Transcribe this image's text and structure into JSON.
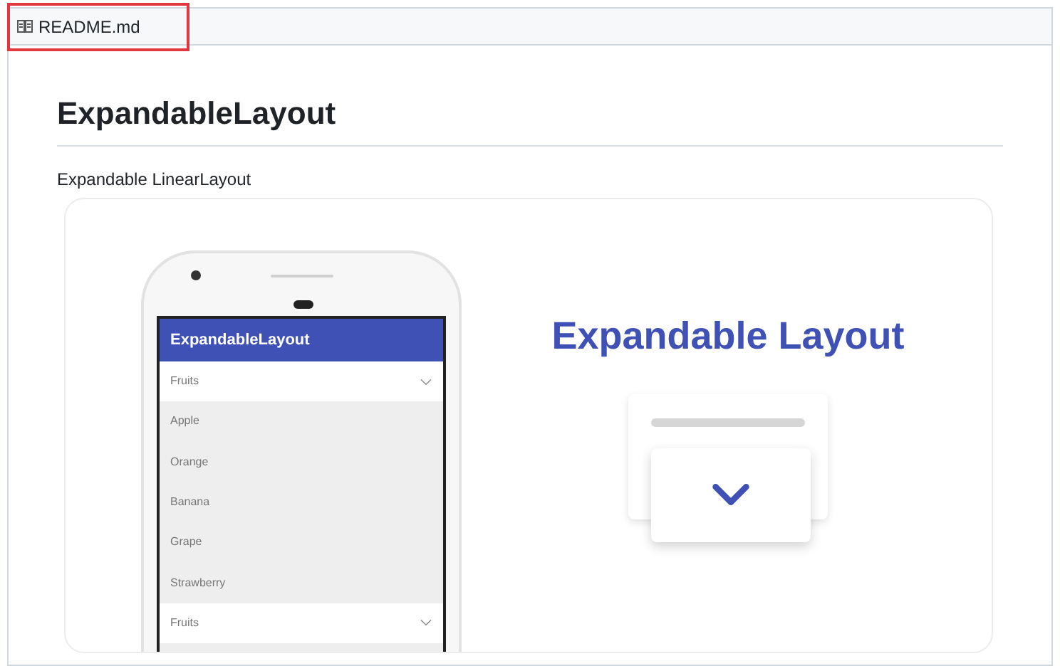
{
  "file_tab": {
    "name": "README.md",
    "highlighted": true
  },
  "heading": "ExpandableLayout",
  "subtitle": "Expandable LinearLayout",
  "banner": {
    "app_title": "ExpandableLayout",
    "title": "Expandable Layout",
    "sections": [
      {
        "label": "Fruits",
        "expanded": true,
        "items": [
          "Apple",
          "Orange",
          "Banana",
          "Grape",
          "Strawberry"
        ]
      },
      {
        "label": "Fruits",
        "expanded": false
      }
    ]
  }
}
